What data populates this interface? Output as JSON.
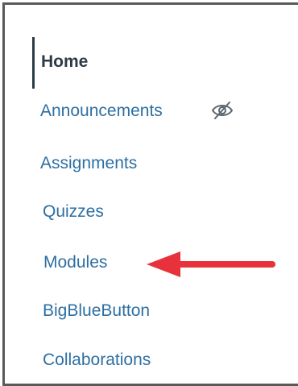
{
  "nav": {
    "items": [
      {
        "label": "Home",
        "active": true
      },
      {
        "label": "Announcements",
        "hidden_icon": "eye-slash-icon"
      },
      {
        "label": "Assignments"
      },
      {
        "label": "Quizzes"
      },
      {
        "label": "Modules",
        "highlighted_by_arrow": true
      },
      {
        "label": "BigBlueButton"
      },
      {
        "label": "Collaborations"
      }
    ]
  },
  "colors": {
    "link": "#2d6fa3",
    "active_text": "#2d3b45",
    "arrow": "#e8323b",
    "frame_border": "#5a5a5a",
    "icon": "#5b6770"
  }
}
